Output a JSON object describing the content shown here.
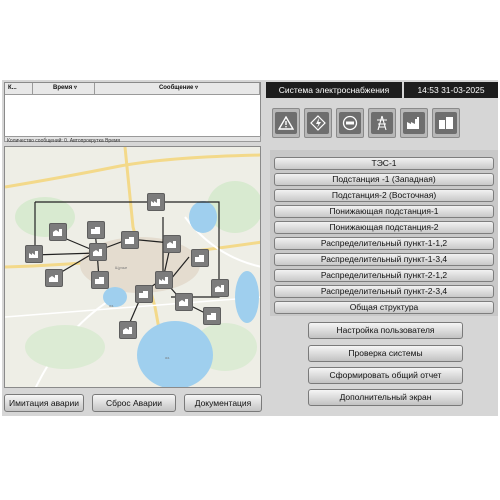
{
  "messages": {
    "columns": [
      "К...",
      "Время",
      "Сообщение"
    ],
    "footer": "Количество сообщений: 0. Автопрокрутка Время"
  },
  "header": {
    "title": "Система электроснабжения",
    "clock": "14:53 31-03-2025"
  },
  "toolbar": {
    "icons": [
      "warning-icon",
      "lightning-icon",
      "meter-icon",
      "power-tower-icon",
      "factory-icon",
      "building-icon"
    ]
  },
  "objects": [
    "ТЭС-1",
    "Подстанция -1 (Западная)",
    "Подстанция-2 (Восточная)",
    "Понижающая подстанция-1",
    "Понижающая подстанция-2",
    "Распределительный пункт-1-1,2",
    "Распределительный пункт-1-3,4",
    "Распределительный пункт-2-1,2",
    "Распределительный пункт-2-3,4",
    "Общая структура"
  ],
  "actions": [
    "Настройка пользователя",
    "Проверка системы",
    "Сформировать общий отчет",
    "Дополнительный экран"
  ],
  "bottom_buttons": {
    "emulate": "Имитация аварии",
    "reset": "Сброс Аварии",
    "docs": "Документация"
  }
}
